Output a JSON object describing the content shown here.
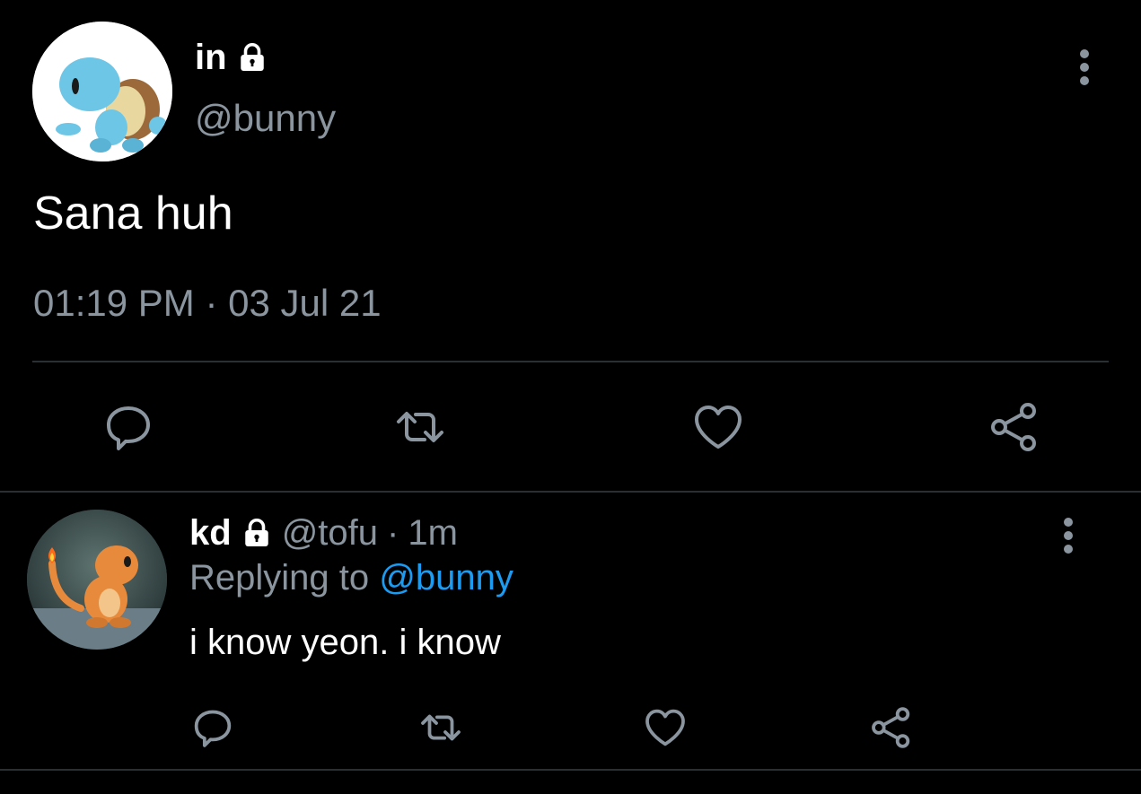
{
  "main_tweet": {
    "display_name": "in",
    "handle": "@bunny",
    "text": "Sana huh",
    "timestamp": "01:19 PM · 03 Jul 21",
    "avatar_icon": "squirtle-avatar",
    "locked": true,
    "actions": [
      "reply-icon",
      "retweet-icon",
      "like-icon",
      "share-icon"
    ]
  },
  "reply_tweet": {
    "display_name": "kd",
    "handle": "@tofu",
    "separator": "·",
    "age": "1m",
    "replying_prefix": "Replying to",
    "replying_to": "@bunny",
    "text": "i know yeon. i know",
    "avatar_icon": "charmander-avatar",
    "locked": true,
    "actions": [
      "reply-icon",
      "retweet-icon",
      "like-icon",
      "share-icon"
    ]
  },
  "colors": {
    "background": "#000000",
    "text_primary": "#ffffff",
    "text_secondary": "#8a959f",
    "link": "#1d9bf0",
    "divider": "#2a2f33",
    "icon": "#8a959f"
  }
}
